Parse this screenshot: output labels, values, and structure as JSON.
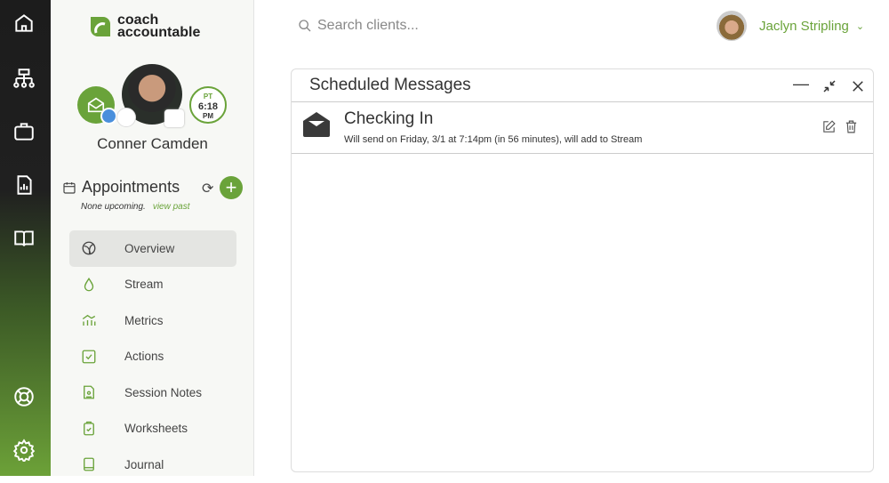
{
  "brand": {
    "name_line1": "coach",
    "name_line2": "accountable",
    "accent": "#6aa33a"
  },
  "rail": {
    "items": [
      "home-icon",
      "hierarchy-icon",
      "briefcase-icon",
      "report-icon",
      "book-icon",
      "lifebuoy-icon",
      "gear-icon"
    ]
  },
  "client": {
    "name": "Conner Camden",
    "tz": "PT",
    "time": "6:18",
    "ampm": "PM"
  },
  "appointments": {
    "title": "Appointments",
    "none": "None upcoming.",
    "view_past": "view past"
  },
  "nav": [
    {
      "label": "Overview"
    },
    {
      "label": "Stream"
    },
    {
      "label": "Metrics"
    },
    {
      "label": "Actions"
    },
    {
      "label": "Session Notes"
    },
    {
      "label": "Worksheets"
    },
    {
      "label": "Journal"
    }
  ],
  "search": {
    "placeholder": "Search clients..."
  },
  "user": {
    "name": "Jaclyn Stripling"
  },
  "panel": {
    "title": "Scheduled Messages",
    "messages": [
      {
        "title": "Checking In",
        "detail": "Will send on Friday, 3/1 at 7:14pm (in 56 minutes), will add to Stream"
      }
    ]
  }
}
